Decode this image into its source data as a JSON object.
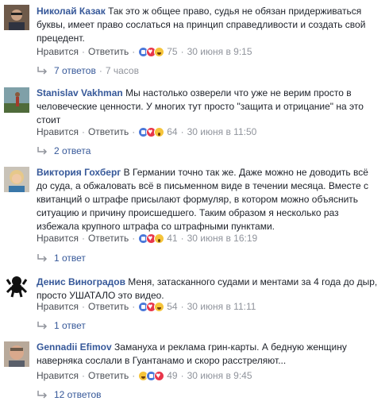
{
  "ui": {
    "like": "Нравится",
    "reply": "Ответить",
    "dot": "·"
  },
  "comments": [
    {
      "author": "Николай Казак",
      "text": "Так это ж общее право, судья не обязан придерживаться буквы, имеет право сослаться на принцип справедливости и создать свой прецедент.",
      "reactions": [
        "like",
        "love",
        "haha"
      ],
      "count": "75",
      "time": "30 июня в 9:15",
      "replies": "7 ответов",
      "replies_time": "7 часов"
    },
    {
      "author": "Stanislav Vakhman",
      "text": "Мы настолько озверели что уже не верим просто в человеческие ценности. У многих тут просто \"защита и отрицание\" на это стоит",
      "reactions": [
        "like",
        "love",
        "wow"
      ],
      "count": "64",
      "time": "30 июня в 11:50",
      "replies": "2 ответа"
    },
    {
      "author": "Виктория Гохберг",
      "text": "В Германии точно так же. Даже можно не доводить всё до суда, а обжаловать всё в письменном виде в течении месяца. Вместе с квитанций о штрафе присылают формуляр, в котором можно объяснить ситуацию и причину происшедшего. Таким образом я несколько раз избежала крупного штрафа со штрафными пунктами.",
      "reactions": [
        "like",
        "love",
        "wow"
      ],
      "count": "41",
      "time": "30 июня в 16:19",
      "replies": "1 ответ"
    },
    {
      "author": "Денис Виноградов",
      "text": "Меня, затасканного судами и ментами за 4 года до дыр, просто УШАТАЛО это видео.",
      "reactions": [
        "like",
        "love",
        "haha"
      ],
      "count": "54",
      "time": "30 июня в 11:11",
      "replies": "1 ответ"
    },
    {
      "author": "Gennadii Efimov",
      "text": "Замануха и реклама грин-карты. А бедную женщину наверняка сослали в Гуантанамо и скоро расстреляют...",
      "reactions": [
        "haha",
        "like",
        "love"
      ],
      "count": "49",
      "time": "30 июня в 9:45",
      "replies": "12 ответов"
    }
  ]
}
